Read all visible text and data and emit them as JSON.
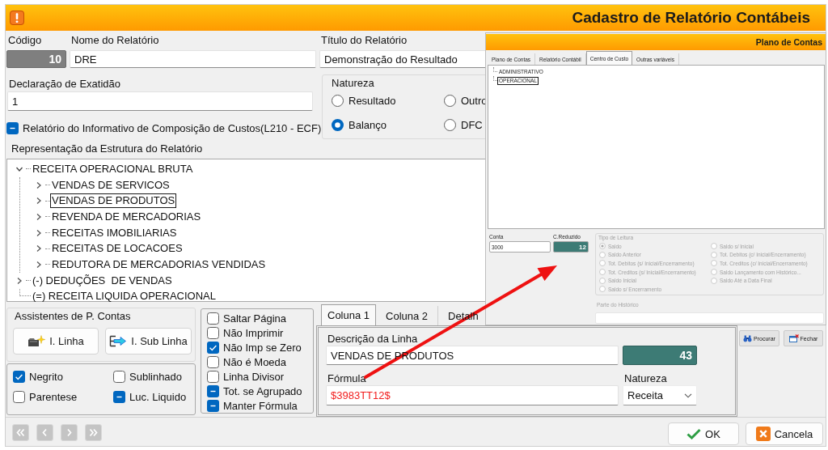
{
  "window": {
    "title": "Cadastro de Relatório Contábeis"
  },
  "header": {
    "code": {
      "label": "Código",
      "value": "10"
    },
    "name": {
      "label": "Nome do Relatório",
      "value": "DRE"
    },
    "report_title": {
      "label": "Título do Relatório",
      "value": "Demonstração do Resultado"
    },
    "declaration": {
      "label": "Declaração de Exatidão",
      "value": "1"
    },
    "cost_report": {
      "label": "Relatório do Informativo de Composição de Custos(L210 - ECF)",
      "indeterminate": true
    }
  },
  "natureza": {
    "title": "Natureza",
    "options": [
      {
        "label": "Resultado",
        "selected": false
      },
      {
        "label": "Outro",
        "selected": false
      },
      {
        "label": "Balanço",
        "selected": true
      },
      {
        "label": "DFC",
        "selected": false
      }
    ]
  },
  "structure": {
    "title": "Representação da Estrutura do Relatório",
    "nodes": [
      {
        "label": "RECEITA OPERACIONAL BRUTA",
        "expanded": true,
        "selected": false,
        "children": [
          {
            "label": "VENDAS DE SERVICOS",
            "expanded": false,
            "selected": false
          },
          {
            "label": "VENDAS DE PRODUTOS",
            "expanded": false,
            "selected": true
          },
          {
            "label": "REVENDA DE MERCADORIAS",
            "expanded": false,
            "selected": false
          },
          {
            "label": "RECEITAS IMOBILIARIAS",
            "expanded": false,
            "selected": false
          },
          {
            "label": "RECEITAS DE LOCACOES",
            "expanded": false,
            "selected": false
          },
          {
            "label": "REDUTORA DE MERCADORIAS VENDIDAS",
            "expanded": false,
            "selected": false
          }
        ]
      },
      {
        "label": "(-) DEDUÇÕES  DE VENDAS",
        "expanded": false,
        "selected": false
      },
      {
        "label": "(=) RECEITA LIQUIDA OPERACIONAL",
        "selected": false
      }
    ]
  },
  "assistants": {
    "title": "Assistentes de P. Contas",
    "buttons": [
      {
        "label": "I. Linha",
        "kind": "insert_line"
      },
      {
        "label": "I. Sub Linha",
        "kind": "insert_subline"
      }
    ]
  },
  "format_options": [
    {
      "label": "Negrito",
      "checked": true,
      "indeterminate": false
    },
    {
      "label": "Sublinhado",
      "checked": false,
      "indeterminate": false
    },
    {
      "label": "Parentese",
      "checked": false,
      "indeterminate": false
    },
    {
      "label": "Luc. Liquido",
      "indeterminate": true
    }
  ],
  "line_options": [
    {
      "label": "Saltar Página",
      "checked": false,
      "indeterminate": false
    },
    {
      "label": "Não Imprimir",
      "checked": false,
      "indeterminate": false
    },
    {
      "label": "Não Imp se Zero",
      "checked": true,
      "indeterminate": false
    },
    {
      "label": "Não é Moeda",
      "checked": false,
      "indeterminate": false
    },
    {
      "label": "Linha Divisor",
      "checked": false,
      "indeterminate": false
    },
    {
      "label": "Tot. se Agrupado",
      "indeterminate": true
    },
    {
      "label": "Manter Fórmula",
      "indeterminate": true
    }
  ],
  "line_tabs": [
    {
      "label": "Coluna 1",
      "selected": true
    },
    {
      "label": "Coluna 2",
      "selected": false
    },
    {
      "label": "Detalh",
      "selected": false
    }
  ],
  "line": {
    "description": {
      "label": "Descrição da Linha",
      "value": "VENDAS DE PRODUTOS"
    },
    "number": "43",
    "formula": {
      "label": "Fórmula",
      "value": "$3983TT12$"
    },
    "natureza": {
      "label": "Natureza",
      "value": "Receita"
    }
  },
  "tools": [
    {
      "label": "Procurar",
      "kind": "search"
    },
    {
      "label": "Fechar",
      "kind": "close"
    }
  ],
  "navigation": [
    {
      "kind": "first",
      "disabled": true
    },
    {
      "kind": "previous",
      "disabled": true
    },
    {
      "kind": "next",
      "disabled": true
    },
    {
      "kind": "last",
      "disabled": true
    }
  ],
  "actions": [
    {
      "label": "OK",
      "kind": "ok"
    },
    {
      "label": "Cancela",
      "kind": "cancel"
    }
  ],
  "accounts_window": {
    "title": "Plano de Contas",
    "tabs": [
      {
        "label": "Plano de Contas",
        "selected": false
      },
      {
        "label": "Relatório Contábil",
        "selected": false
      },
      {
        "label": "Centro de Custo",
        "selected": true
      },
      {
        "label": "Outras variáveis",
        "selected": false
      }
    ],
    "cost_centers": [
      {
        "label": "ADMINISTRATIVO",
        "selected": false
      },
      {
        "label": "OPERACIONAL",
        "selected": true
      }
    ],
    "account": {
      "label": "Conta",
      "value": "3000"
    },
    "reduced_code": {
      "label": "C.Reduzido",
      "value": "12"
    },
    "reading_type": {
      "title": "Tipo de Leitura",
      "disabled": true,
      "options": [
        {
          "label": "Saldo",
          "selected": true
        },
        {
          "label": "Saldo Anterior",
          "selected": false
        },
        {
          "label": "Tot. Debitos (s/ Inicial/Encerramento)",
          "selected": false
        },
        {
          "label": "Tot. Creditos (s/ Inicial/Encerramento)",
          "selected": false
        },
        {
          "label": "Saldo Inicial",
          "selected": false
        },
        {
          "label": "Saldo s/ Encerramento",
          "selected": false
        },
        {
          "label": "Saldo s/ Inicial",
          "selected": false
        },
        {
          "label": "Tot. Debitos (c/ Inicial/Encerramento)",
          "selected": false
        },
        {
          "label": "Tot. Creditos (c/ Inicial/Encerramento)",
          "selected": false
        },
        {
          "label": "Saldo Lançamento com Histórico...",
          "selected": false
        },
        {
          "label": "Saldo Até a Data Final",
          "selected": false
        }
      ]
    },
    "history_part": {
      "label": "Parte do Histórico",
      "disabled": true
    }
  }
}
